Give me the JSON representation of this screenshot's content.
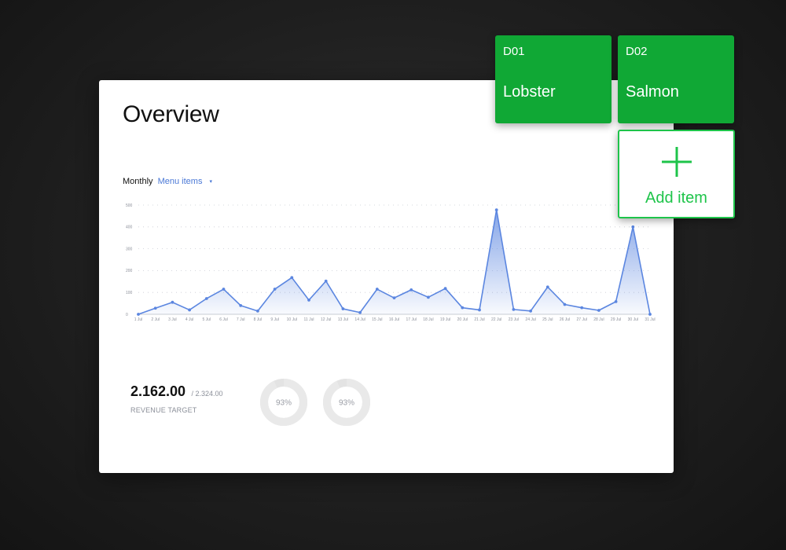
{
  "overview": {
    "title": "Overview",
    "period_label": "Monthly",
    "metric_dropdown": "Menu items"
  },
  "chart_data": {
    "type": "area",
    "x": [
      "1 Jul",
      "2 Jul",
      "3 Jul",
      "4 Jul",
      "5 Jul",
      "6 Jul",
      "7 Jul",
      "8 Jul",
      "9 Jul",
      "10 Jul",
      "11 Jul",
      "12 Jul",
      "13 Jul",
      "14 Jul",
      "15 Jul",
      "16 Jul",
      "17 Jul",
      "18 Jul",
      "19 Jul",
      "20 Jul",
      "21 Jul",
      "22 Jul",
      "23 Jul",
      "24 Jul",
      "25 Jul",
      "26 Jul",
      "27 Jul",
      "28 Jul",
      "29 Jul",
      "30 Jul",
      "31 Jul"
    ],
    "values": [
      0,
      28,
      55,
      20,
      72,
      115,
      40,
      15,
      115,
      168,
      65,
      152,
      25,
      8,
      115,
      75,
      112,
      78,
      118,
      30,
      20,
      478,
      22,
      15,
      125,
      45,
      30,
      18,
      58,
      400,
      0
    ],
    "yticks": [
      0,
      100,
      200,
      300,
      400,
      500
    ],
    "ylim": [
      0,
      500
    ],
    "grid": true,
    "color": "#5b86e0"
  },
  "revenue": {
    "value": "2.162.00",
    "target": "/ 2.324.00",
    "label": "REVENUE TARGET"
  },
  "gauges": [
    {
      "label": "93%",
      "value": 93
    },
    {
      "label": "93%",
      "value": 93
    }
  ],
  "menu_cards": [
    {
      "code": "D01",
      "name": "Lobster"
    },
    {
      "code": "D02",
      "name": "Salmon"
    }
  ],
  "add_item": {
    "label": "Add item",
    "icon": "plus-icon"
  },
  "colors": {
    "card_green": "#10a835",
    "add_green": "#1ec44a",
    "accent_blue": "#4a78d6"
  }
}
